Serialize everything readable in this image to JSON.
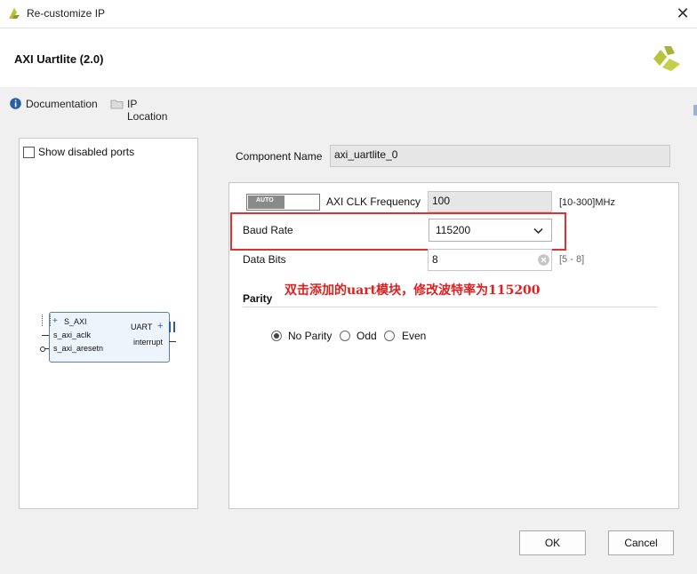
{
  "window": {
    "title": "Re-customize IP",
    "close_glyph": "✕"
  },
  "header": {
    "ip_name": "AXI Uartlite (2.0)"
  },
  "links": {
    "documentation": "Documentation",
    "ip_location": "IP Location"
  },
  "left_panel": {
    "show_disabled_ports": "Show disabled ports",
    "block": {
      "bus_port": "S_AXI",
      "clk_port": "s_axi_aclk",
      "reset_port": "s_axi_aresetn",
      "uart_port": "UART",
      "interrupt_port": "interrupt"
    }
  },
  "component": {
    "label": "Component Name",
    "value": "axi_uartlite_0"
  },
  "params": {
    "auto_badge": "AUTO",
    "clk_label": "AXI CLK Frequency",
    "clk_value": "100",
    "clk_range": "[10-300]MHz",
    "baud_label": "Baud Rate",
    "baud_value": "115200",
    "data_bits_label": "Data Bits",
    "data_bits_value": "8",
    "data_bits_range": "[5 - 8]",
    "annotation": "双击添加的uart模块，修改波特率为115200",
    "parity_label": "Parity",
    "parity_options": [
      "No Parity",
      "Odd",
      "Even"
    ],
    "parity_selected": "No Parity"
  },
  "buttons": {
    "ok": "OK",
    "cancel": "Cancel"
  },
  "colors": {
    "highlight_box": "#e03030",
    "annotation_text": "#e02020",
    "logo": "#a9b73a"
  }
}
